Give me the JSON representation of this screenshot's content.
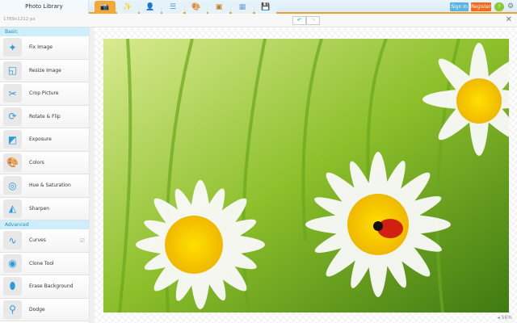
{
  "header": {
    "title": "Photo Library",
    "tabs": [
      {
        "icon": "camera-icon",
        "active": true
      },
      {
        "icon": "magic-wand-icon"
      },
      {
        "icon": "person-icon"
      },
      {
        "icon": "layers-icon"
      },
      {
        "icon": "palette-icon"
      },
      {
        "icon": "frame-icon"
      },
      {
        "icon": "texture-icon"
      },
      {
        "icon": "save-icon"
      }
    ],
    "sign_in": "Sign In",
    "register": "Register"
  },
  "toolbar": {
    "dimensions": "1789x1212 px"
  },
  "sidebar": {
    "basic_label": "Basic",
    "advanced_label": "Advanced",
    "basic": [
      {
        "label": "Fix Image",
        "icon": "✦"
      },
      {
        "label": "Resize Image",
        "icon": "◱"
      },
      {
        "label": "Crop Picture",
        "icon": "✂"
      },
      {
        "label": "Rotate & Flip",
        "icon": "⟳"
      },
      {
        "label": "Exposure",
        "icon": "◩"
      },
      {
        "label": "Colors",
        "icon": "🎨"
      },
      {
        "label": "Hue & Saturation",
        "icon": "◎"
      },
      {
        "label": "Sharpen",
        "icon": "◭"
      }
    ],
    "advanced": [
      {
        "label": "Curves",
        "icon": "∿"
      },
      {
        "label": "Clone Tool",
        "icon": "◉"
      },
      {
        "label": "Erase Background",
        "icon": "⬮"
      },
      {
        "label": "Dodge",
        "icon": "⚲"
      }
    ]
  },
  "status": {
    "zoom": "56%"
  },
  "colors": {
    "accent": "#f7a833",
    "sign_in": "#5ab4e0",
    "register": "#f26a1b"
  }
}
